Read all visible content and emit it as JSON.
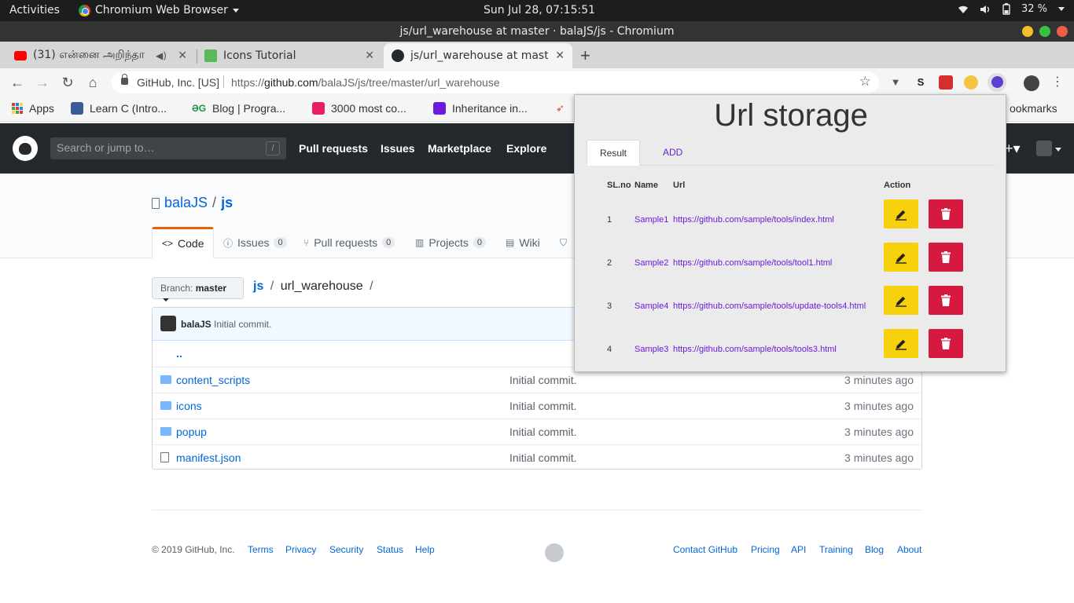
{
  "topbar": {
    "activities": "Activities",
    "app_name": "Chromium Web Browser",
    "clock": "Sun Jul 28, 07:15:51",
    "battery": "32 %"
  },
  "window": {
    "title": "js/url_warehouse at master · balaJS/js - Chromium"
  },
  "tabs": [
    {
      "label": "(31) என்னை அறிந்தா",
      "active": false
    },
    {
      "label": "Icons Tutorial",
      "active": false
    },
    {
      "label": "js/url_warehouse at mast",
      "active": true
    }
  ],
  "toolbar": {
    "site_identity": "GitHub, Inc. [US]",
    "url_prefix": "https://",
    "url_host": "github.com",
    "url_path": "/balaJS/js/tree/master/url_warehouse"
  },
  "bookmarks": {
    "items": [
      {
        "label": "Apps"
      },
      {
        "label": "Learn C (Intro..."
      },
      {
        "label": "Blog | Progra..."
      },
      {
        "label": "3000 most co..."
      },
      {
        "label": "Inheritance in..."
      }
    ],
    "other": "ookmarks"
  },
  "github": {
    "search_placeholder": "Search or jump to…",
    "search_key": "/",
    "nav": [
      "Pull requests",
      "Issues",
      "Marketplace",
      "Explore"
    ],
    "owner": "balaJS",
    "repo": "js",
    "repo_tabs": [
      {
        "label": "Code",
        "count": ""
      },
      {
        "label": "Issues",
        "count": "0"
      },
      {
        "label": "Pull requests",
        "count": "0"
      },
      {
        "label": "Projects",
        "count": "0"
      },
      {
        "label": "Wiki",
        "count": ""
      }
    ],
    "branch_label": "Branch:",
    "branch_value": "master",
    "breadcrumb": {
      "root": "js",
      "dir": "url_warehouse",
      "trail": "/"
    },
    "commit": {
      "user": "balaJS",
      "message": "Initial commit."
    },
    "parent_dir": "..",
    "files": [
      {
        "name": "content_scripts",
        "type": "folder",
        "message": "Initial commit.",
        "age": "3 minutes ago"
      },
      {
        "name": "icons",
        "type": "folder",
        "message": "Initial commit.",
        "age": "3 minutes ago"
      },
      {
        "name": "popup",
        "type": "folder",
        "message": "Initial commit.",
        "age": "3 minutes ago"
      },
      {
        "name": "manifest.json",
        "type": "file",
        "message": "Initial commit.",
        "age": "3 minutes ago"
      }
    ],
    "footer": {
      "copyright": "© 2019 GitHub, Inc.",
      "left_links": [
        "Terms",
        "Privacy",
        "Security",
        "Status",
        "Help"
      ],
      "right_links": [
        "Contact GitHub",
        "Pricing",
        "API",
        "Training",
        "Blog",
        "About"
      ]
    }
  },
  "popup": {
    "title": "Url storage",
    "tabs": [
      "Result",
      "ADD"
    ],
    "columns": [
      "SL.no",
      "Name",
      "Url",
      "Action"
    ],
    "rows": [
      {
        "sl": "1",
        "name": "Sample1",
        "url": "https://github.com/sample/tools/index.html"
      },
      {
        "sl": "2",
        "name": "Sample2",
        "url": "https://github.com/sample/tools/tool1.html"
      },
      {
        "sl": "3",
        "name": "Sample4",
        "url": "https://github.com/sample/tools/update-tools4.html"
      },
      {
        "sl": "4",
        "name": "Sample3",
        "url": "https://github.com/sample/tools/tools3.html"
      }
    ],
    "colors": {
      "edit": "#f6d10c",
      "delete": "#d6193f",
      "link": "#6a1bdc"
    }
  }
}
